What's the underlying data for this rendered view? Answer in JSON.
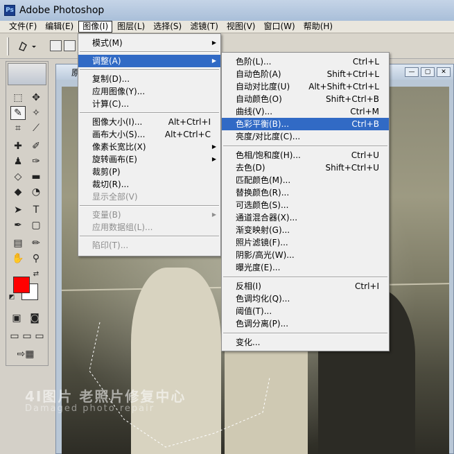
{
  "window": {
    "title": "Adobe Photoshop",
    "logo": "Ps"
  },
  "menubar": [
    "文件(F)",
    "编辑(E)",
    "图像(I)",
    "图层(L)",
    "选择(S)",
    "滤镜(T)",
    "视图(V)",
    "窗口(W)",
    "帮助(H)"
  ],
  "document": {
    "title": "原"
  },
  "image_menu": [
    {
      "label": "模式(M)",
      "sub": true
    },
    {
      "sep": true
    },
    {
      "label": "调整(A)",
      "sub": true,
      "highlight": true
    },
    {
      "sep": true
    },
    {
      "label": "复制(D)..."
    },
    {
      "label": "应用图像(Y)..."
    },
    {
      "label": "计算(C)..."
    },
    {
      "sep": true
    },
    {
      "label": "图像大小(I)...",
      "shortcut": "Alt+Ctrl+I"
    },
    {
      "label": "画布大小(S)...",
      "shortcut": "Alt+Ctrl+C"
    },
    {
      "label": "像素长宽比(X)",
      "sub": true
    },
    {
      "label": "旋转画布(E)",
      "sub": true
    },
    {
      "label": "裁剪(P)"
    },
    {
      "label": "裁切(R)..."
    },
    {
      "label": "显示全部(V)",
      "disabled": true
    },
    {
      "sep": true
    },
    {
      "label": "变量(B)",
      "sub": true,
      "disabled": true
    },
    {
      "label": "应用数据组(L)...",
      "disabled": true
    },
    {
      "sep": true
    },
    {
      "label": "陷印(T)...",
      "disabled": true
    }
  ],
  "adjust_menu": [
    {
      "label": "色阶(L)...",
      "shortcut": "Ctrl+L"
    },
    {
      "label": "自动色阶(A)",
      "shortcut": "Shift+Ctrl+L"
    },
    {
      "label": "自动对比度(U)",
      "shortcut": "Alt+Shift+Ctrl+L"
    },
    {
      "label": "自动颜色(O)",
      "shortcut": "Shift+Ctrl+B"
    },
    {
      "label": "曲线(V)...",
      "shortcut": "Ctrl+M"
    },
    {
      "label": "色彩平衡(B)...",
      "shortcut": "Ctrl+B",
      "highlight": true
    },
    {
      "label": "亮度/对比度(C)..."
    },
    {
      "sep": true
    },
    {
      "label": "色相/饱和度(H)...",
      "shortcut": "Ctrl+U"
    },
    {
      "label": "去色(D)",
      "shortcut": "Shift+Ctrl+U"
    },
    {
      "label": "匹配颜色(M)..."
    },
    {
      "label": "替换颜色(R)..."
    },
    {
      "label": "可选颜色(S)..."
    },
    {
      "label": "通道混合器(X)..."
    },
    {
      "label": "渐变映射(G)..."
    },
    {
      "label": "照片滤镜(F)..."
    },
    {
      "label": "阴影/高光(W)..."
    },
    {
      "label": "曝光度(E)..."
    },
    {
      "sep": true
    },
    {
      "label": "反相(I)",
      "shortcut": "Ctrl+I"
    },
    {
      "label": "色调均化(Q)..."
    },
    {
      "label": "阈值(T)..."
    },
    {
      "label": "色调分离(P)..."
    },
    {
      "sep": true
    },
    {
      "label": "变化..."
    }
  ],
  "watermark": {
    "line1": "4I图片 老照片修复中心",
    "line2": "Damaged photo repair"
  },
  "colors": {
    "foreground": "#ff0000",
    "background": "#ffffff",
    "highlight": "#316ac5"
  }
}
